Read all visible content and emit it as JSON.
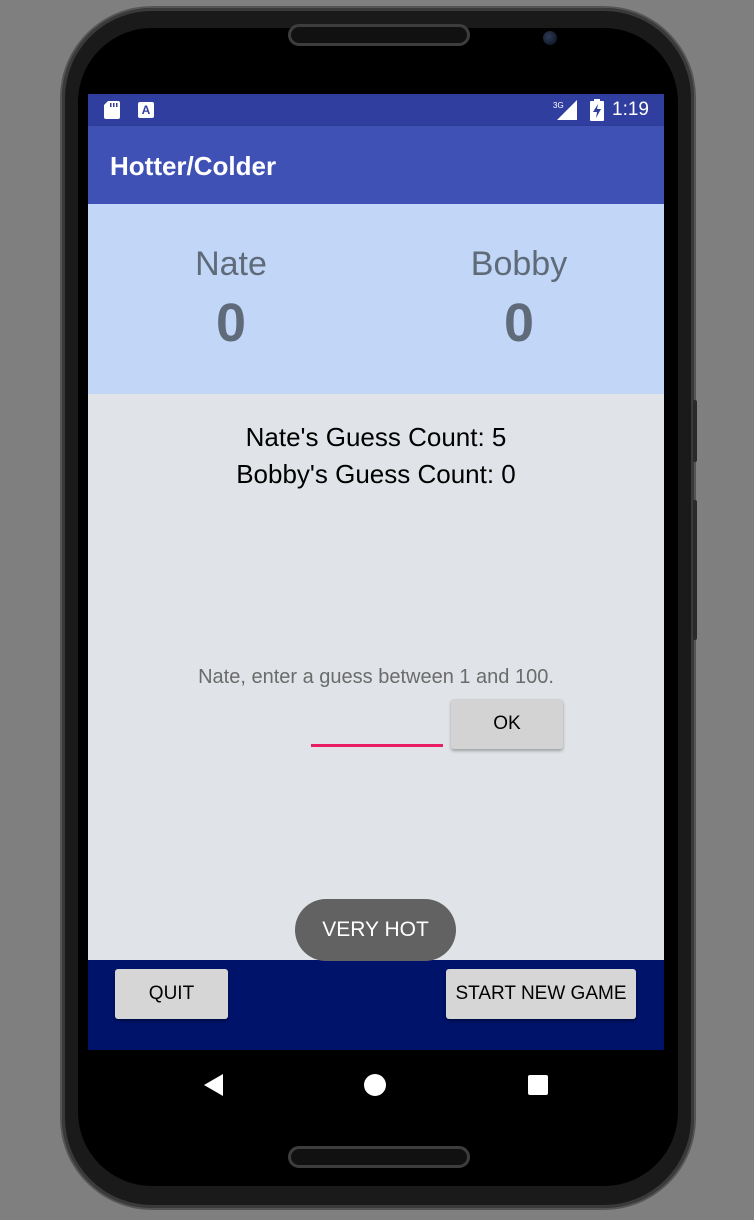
{
  "status_bar": {
    "time": "1:19",
    "network": "3G",
    "icons": [
      "sd-card-icon",
      "a-notification-icon",
      "signal-icon",
      "battery-charging-icon"
    ]
  },
  "app_bar": {
    "title": "Hotter/Colder"
  },
  "scoreboard": {
    "players": [
      {
        "name": "Nate",
        "score": "0"
      },
      {
        "name": "Bobby",
        "score": "0"
      }
    ]
  },
  "guess_counts": {
    "nate": "Nate's Guess Count: 5",
    "bobby": "Bobby's Guess Count: 0"
  },
  "guess": {
    "prompt": "Nate, enter a guess between 1 and 100.",
    "input_value": "",
    "ok_label": "OK"
  },
  "toast": {
    "text": "VERY HOT"
  },
  "footer": {
    "quit_label": "QUIT",
    "new_game_label": "START NEW GAME"
  },
  "nav_bar": {
    "icons": [
      "back-icon",
      "home-icon",
      "recents-icon"
    ]
  },
  "colors": {
    "status_bar": "#303f9f",
    "app_bar": "#3f51b5",
    "scoreboard_bg": "#c2d6f8",
    "footer_bg": "#00136b",
    "input_underline": "#e91e63"
  }
}
